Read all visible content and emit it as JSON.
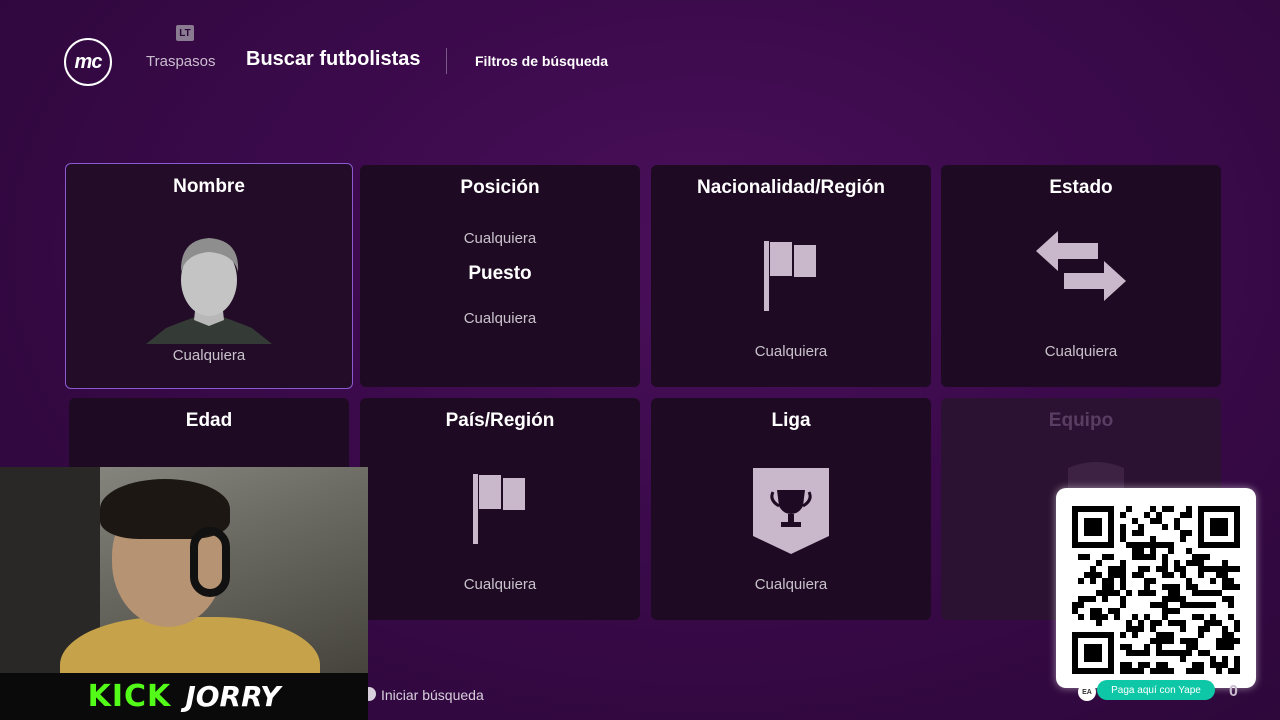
{
  "header": {
    "logo": "mc",
    "lt_badge": "LT",
    "tab_traspasos": "Traspasos",
    "tab_buscar": "Buscar futbolistas",
    "tab_filtros": "Filtros de búsqueda"
  },
  "cards": {
    "nombre": {
      "title": "Nombre",
      "value": "Cualquiera"
    },
    "posicion": {
      "title": "Posición",
      "value": "Cualquiera",
      "subtitle": "Puesto",
      "subvalue": "Cualquiera"
    },
    "nacionalidad": {
      "title": "Nacionalidad/Región",
      "value": "Cualquiera"
    },
    "estado": {
      "title": "Estado",
      "value": "Cualquiera"
    },
    "edad": {
      "title": "Edad"
    },
    "pais": {
      "title": "País/Región",
      "value": "Cualquiera"
    },
    "liga": {
      "title": "Liga",
      "value": "Cualquiera"
    },
    "equipo": {
      "title": "Equipo"
    }
  },
  "footer": {
    "hint": "Iniciar búsqueda",
    "coins": "0"
  },
  "overlay": {
    "kick_logo": "KICK",
    "streamer": "JORRY",
    "qr_caption": "Paga aquí con Yape",
    "ea": "EA"
  },
  "colors": {
    "accent": "#8a5bd0",
    "card_bg": "#1e0a22",
    "icon": "#c9b8cc",
    "kick_green": "#53fc18",
    "yape": "#0ec7a6"
  }
}
